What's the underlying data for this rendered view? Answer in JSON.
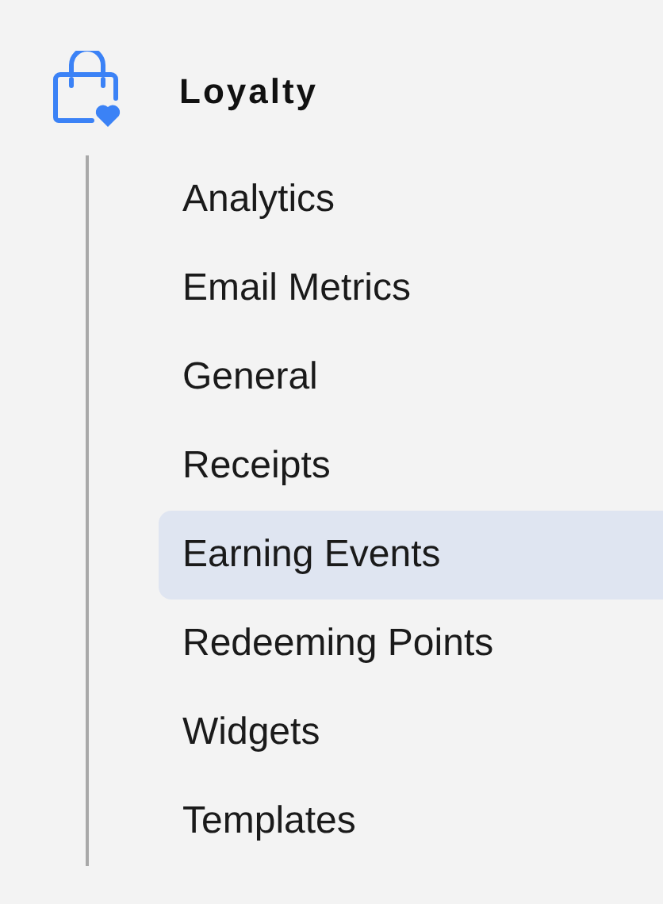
{
  "section": {
    "title": "Loyalty"
  },
  "items": [
    {
      "label": "Analytics",
      "selected": false
    },
    {
      "label": "Email Metrics",
      "selected": false
    },
    {
      "label": "General",
      "selected": false
    },
    {
      "label": "Receipts",
      "selected": false
    },
    {
      "label": "Earning Events",
      "selected": true
    },
    {
      "label": "Redeeming Points",
      "selected": false
    },
    {
      "label": "Widgets",
      "selected": false
    },
    {
      "label": "Templates",
      "selected": false
    }
  ]
}
